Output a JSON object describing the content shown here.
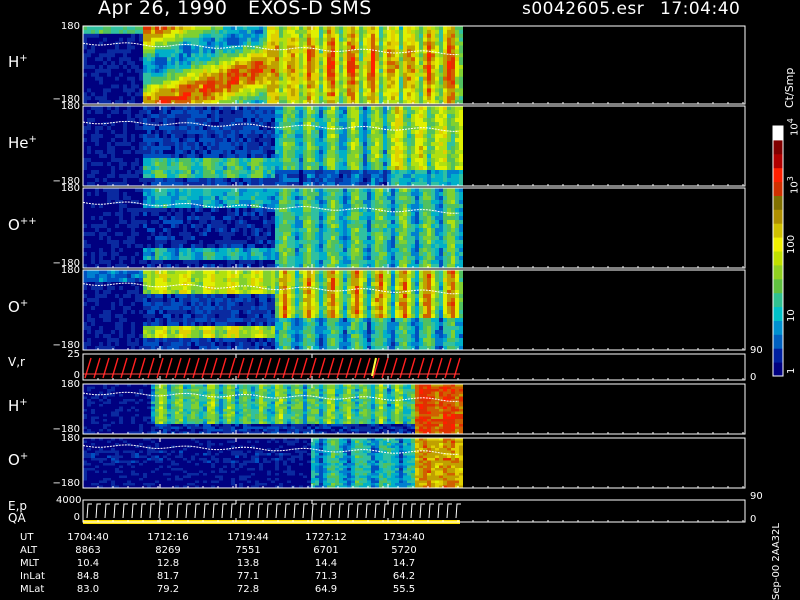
{
  "header": {
    "date": "Apr 26, 1990",
    "instrument": "EXOS-D SMS",
    "file": "s0042605.esr",
    "time": "17:04:40"
  },
  "colorbar": {
    "unit": "Ct/Smp",
    "ticks": [
      {
        "label": "1",
        "sup": ""
      },
      {
        "label": "10",
        "sup": ""
      },
      {
        "label": "100",
        "sup": ""
      },
      {
        "label": "10",
        "sup": "3"
      },
      {
        "label": "10",
        "sup": "4"
      }
    ],
    "colors": [
      "#000080",
      "#0020a0",
      "#0060c0",
      "#0090d0",
      "#00c0c8",
      "#30c090",
      "#60c040",
      "#90d020",
      "#c0e000",
      "#f0f000",
      "#d0c000",
      "#b09000",
      "#807000",
      "#d03000",
      "#ff2000",
      "#b00000",
      "#800000",
      "#ffffff"
    ]
  },
  "panels": [
    {
      "species": "H",
      "sup": "+",
      "top": "180",
      "bottom": "−180"
    },
    {
      "species": "He",
      "sup": "+",
      "top": "180",
      "bottom": "−180"
    },
    {
      "species": "O",
      "sup": "++",
      "top": "180",
      "bottom": "−180"
    },
    {
      "species": "O",
      "sup": "+",
      "top": "180",
      "bottom": "−180"
    },
    {
      "species": "V,r",
      "sup": "",
      "top": "25",
      "bottom": "0",
      "right_top": "90",
      "right_bottom": "0"
    },
    {
      "species": "H",
      "sup": "+",
      "top": "180",
      "bottom": "−180"
    },
    {
      "species": "O",
      "sup": "+",
      "top": "180",
      "bottom": "−180"
    },
    {
      "species": "E,p",
      "species2": "QA",
      "sup": "",
      "top": "4000",
      "bottom": "0",
      "right_top": "90",
      "right_bottom": "0"
    }
  ],
  "chart_data": {
    "type": "heatmap",
    "title": "Apr 26, 1990  EXOS-D SMS",
    "x_ticks": [
      "1704:40",
      "1712:16",
      "1719:44",
      "1727:12",
      "1734:40"
    ],
    "colorbar_scale": "log",
    "colorbar_range": [
      1,
      10000
    ]
  },
  "table": {
    "rows": [
      {
        "label": "UT",
        "values": [
          "1704:40",
          "1712:16",
          "1719:44",
          "1727:12",
          "1734:40"
        ]
      },
      {
        "label": "ALT",
        "values": [
          "8863",
          "8269",
          "7551",
          "6701",
          "5720"
        ]
      },
      {
        "label": "MLT",
        "values": [
          "10.4",
          "12.8",
          "13.8",
          "14.4",
          "14.7"
        ]
      },
      {
        "label": "InLat",
        "values": [
          "84.8",
          "81.7",
          "77.1",
          "71.3",
          "64.2"
        ]
      },
      {
        "label": "MLat",
        "values": [
          "83.0",
          "79.2",
          "72.8",
          "64.9",
          "55.5"
        ]
      }
    ]
  },
  "footer": {
    "version": "Sep-00 2AA32L"
  }
}
